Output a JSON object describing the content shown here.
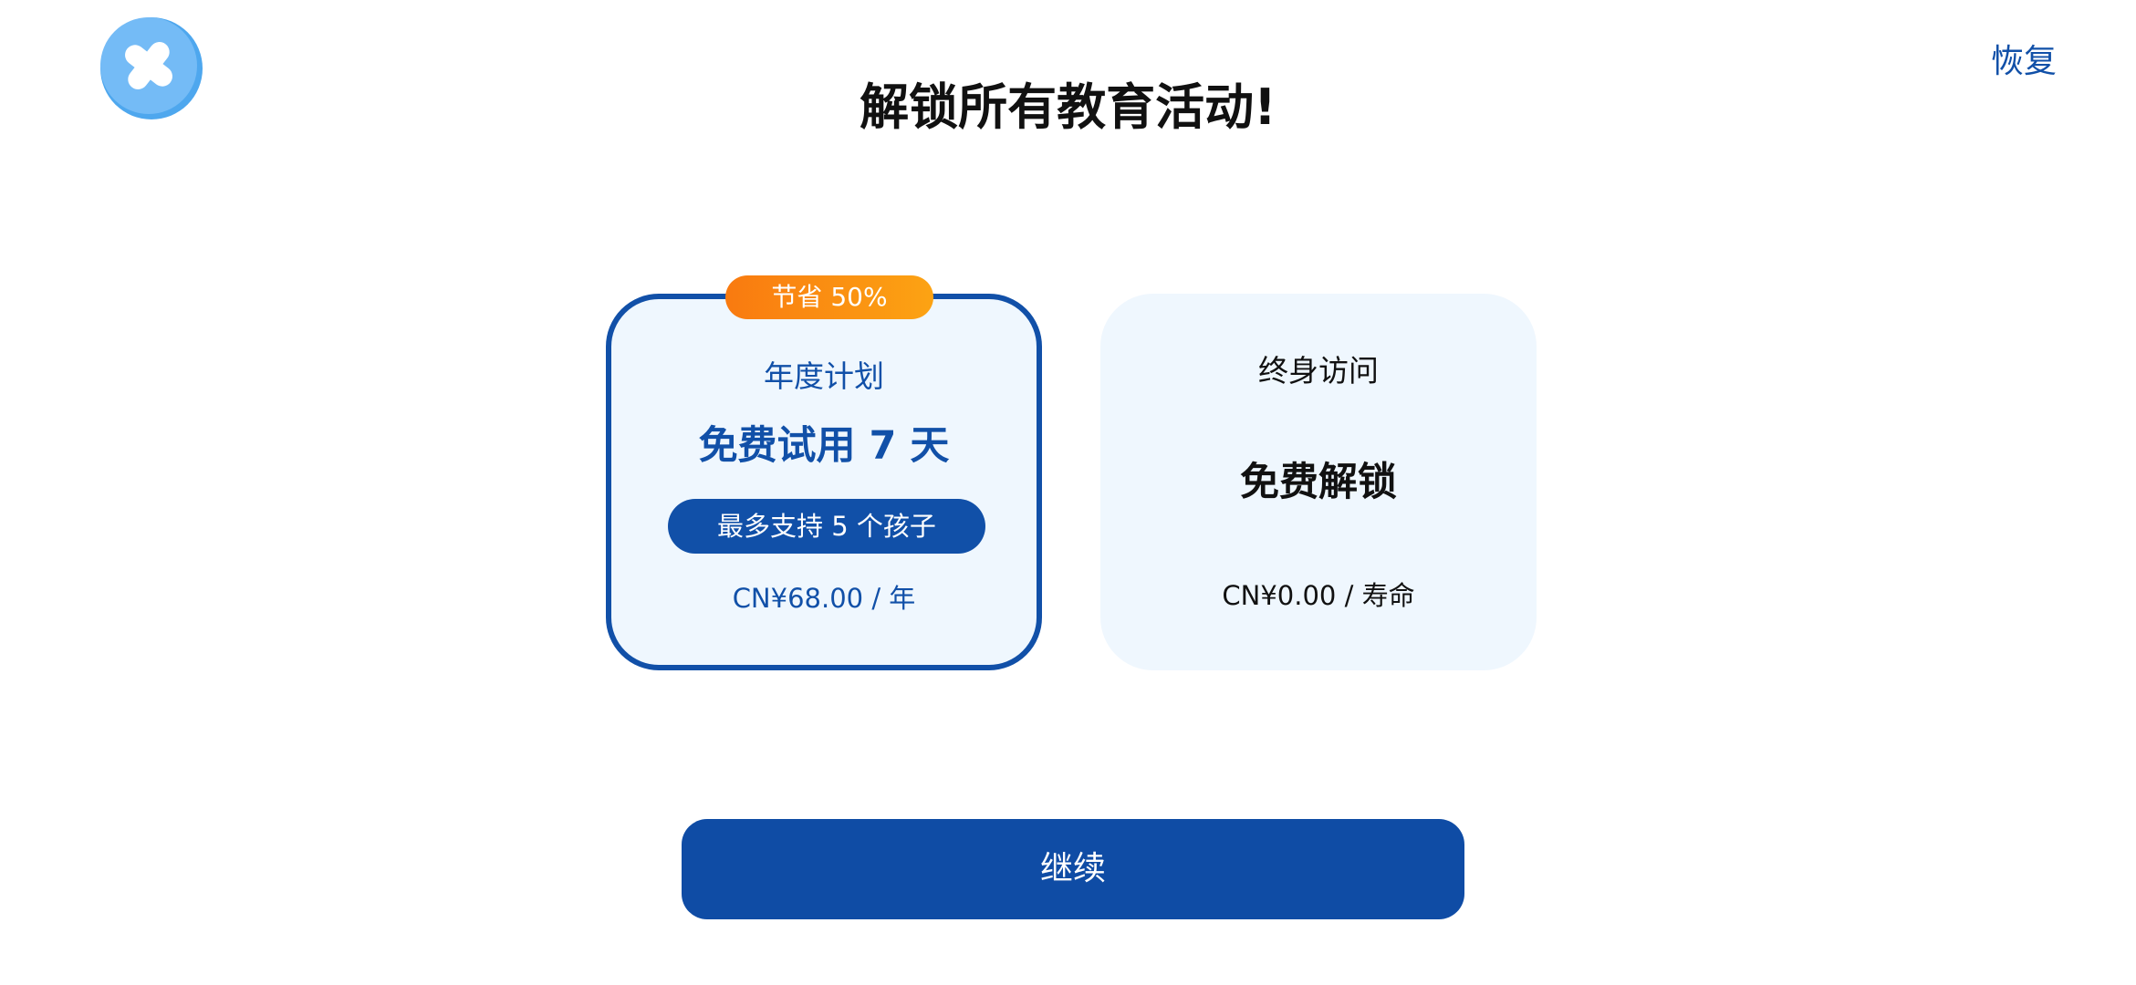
{
  "header": {
    "close_icon": "close-icon",
    "restore_label": "恢复",
    "title": "解锁所有教育活动!"
  },
  "plans": {
    "annual": {
      "badge": "节省 50%",
      "label": "年度计划",
      "headline": "免费试用 7 天",
      "kids_note": "最多支持 5 个孩子",
      "price": "CN¥68.00 / 年",
      "selected": true
    },
    "lifetime": {
      "label": "终身访问",
      "headline": "免费解锁",
      "price": "CN¥0.00 / 寿命",
      "selected": false
    }
  },
  "footer": {
    "continue_label": "继续"
  },
  "colors": {
    "primary": "#1150a8",
    "card_bg": "#eff7fe",
    "badge_start": "#f97a10",
    "badge_end": "#fca313",
    "close_button": "#74bbf6"
  }
}
